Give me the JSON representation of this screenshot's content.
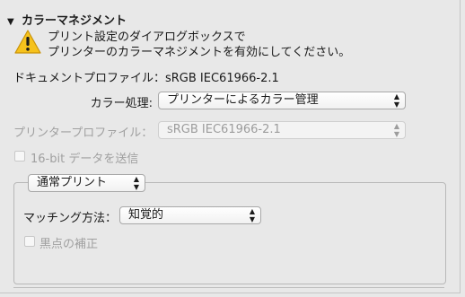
{
  "section": {
    "title": "カラーマネジメント",
    "warning_lines": [
      "プリント設定のダイアログボックスで",
      "プリンターのカラーマネジメントを有効にしてください。"
    ],
    "document_profile": "ドキュメントプロファイル：sRGB IEC61966-2.1"
  },
  "color_handling": {
    "label": "カラー処理:",
    "value": "プリンターによるカラー管理"
  },
  "printer_profile": {
    "label": "プリンタープロファイル：",
    "value": "sRGB IEC61966-2.1"
  },
  "send_16bit": {
    "label": "16-bit データを送信"
  },
  "print_mode": {
    "value": "通常プリント"
  },
  "rendering_intent": {
    "label": "マッチング方法：",
    "value": "知覚的"
  },
  "black_point": {
    "label": "黒点の補正"
  }
}
